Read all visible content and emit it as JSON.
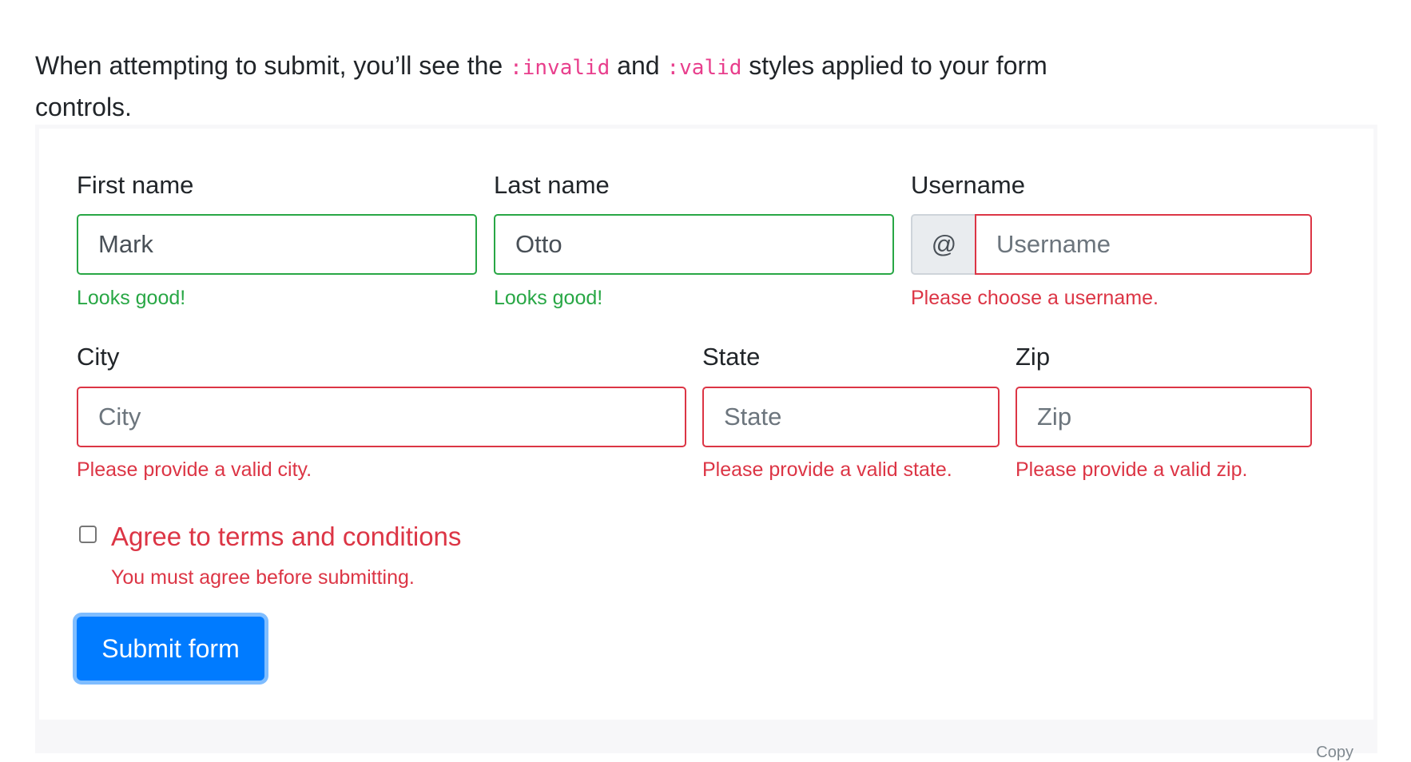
{
  "intro": {
    "text_before": "When attempting to submit, you’ll see the ",
    "code_invalid": ":invalid",
    "text_between": " and ",
    "code_valid": ":valid",
    "text_after": " styles applied to your form controls."
  },
  "form": {
    "first_name": {
      "label": "First name",
      "value": "Mark",
      "state": "valid",
      "feedback": "Looks good!"
    },
    "last_name": {
      "label": "Last name",
      "value": "Otto",
      "state": "valid",
      "feedback": "Looks good!"
    },
    "username": {
      "label": "Username",
      "prepend": "@",
      "placeholder": "Username",
      "state": "invalid",
      "feedback": "Please choose a username."
    },
    "city": {
      "label": "City",
      "placeholder": "City",
      "state": "invalid",
      "feedback": "Please provide a valid city."
    },
    "state": {
      "label": "State",
      "placeholder": "State",
      "state": "invalid",
      "feedback": "Please provide a valid state."
    },
    "zip": {
      "label": "Zip",
      "placeholder": "Zip",
      "state": "invalid",
      "feedback": "Please provide a valid zip."
    },
    "agree": {
      "label": "Agree to terms and conditions",
      "checked": false,
      "feedback": "You must agree before submitting."
    },
    "submit_label": "Submit form"
  },
  "code_strip": {
    "copy_label": "Copy"
  },
  "colors": {
    "valid": "#28a745",
    "invalid": "#dc3545",
    "primary": "#007bff",
    "code": "#e83e8c"
  }
}
